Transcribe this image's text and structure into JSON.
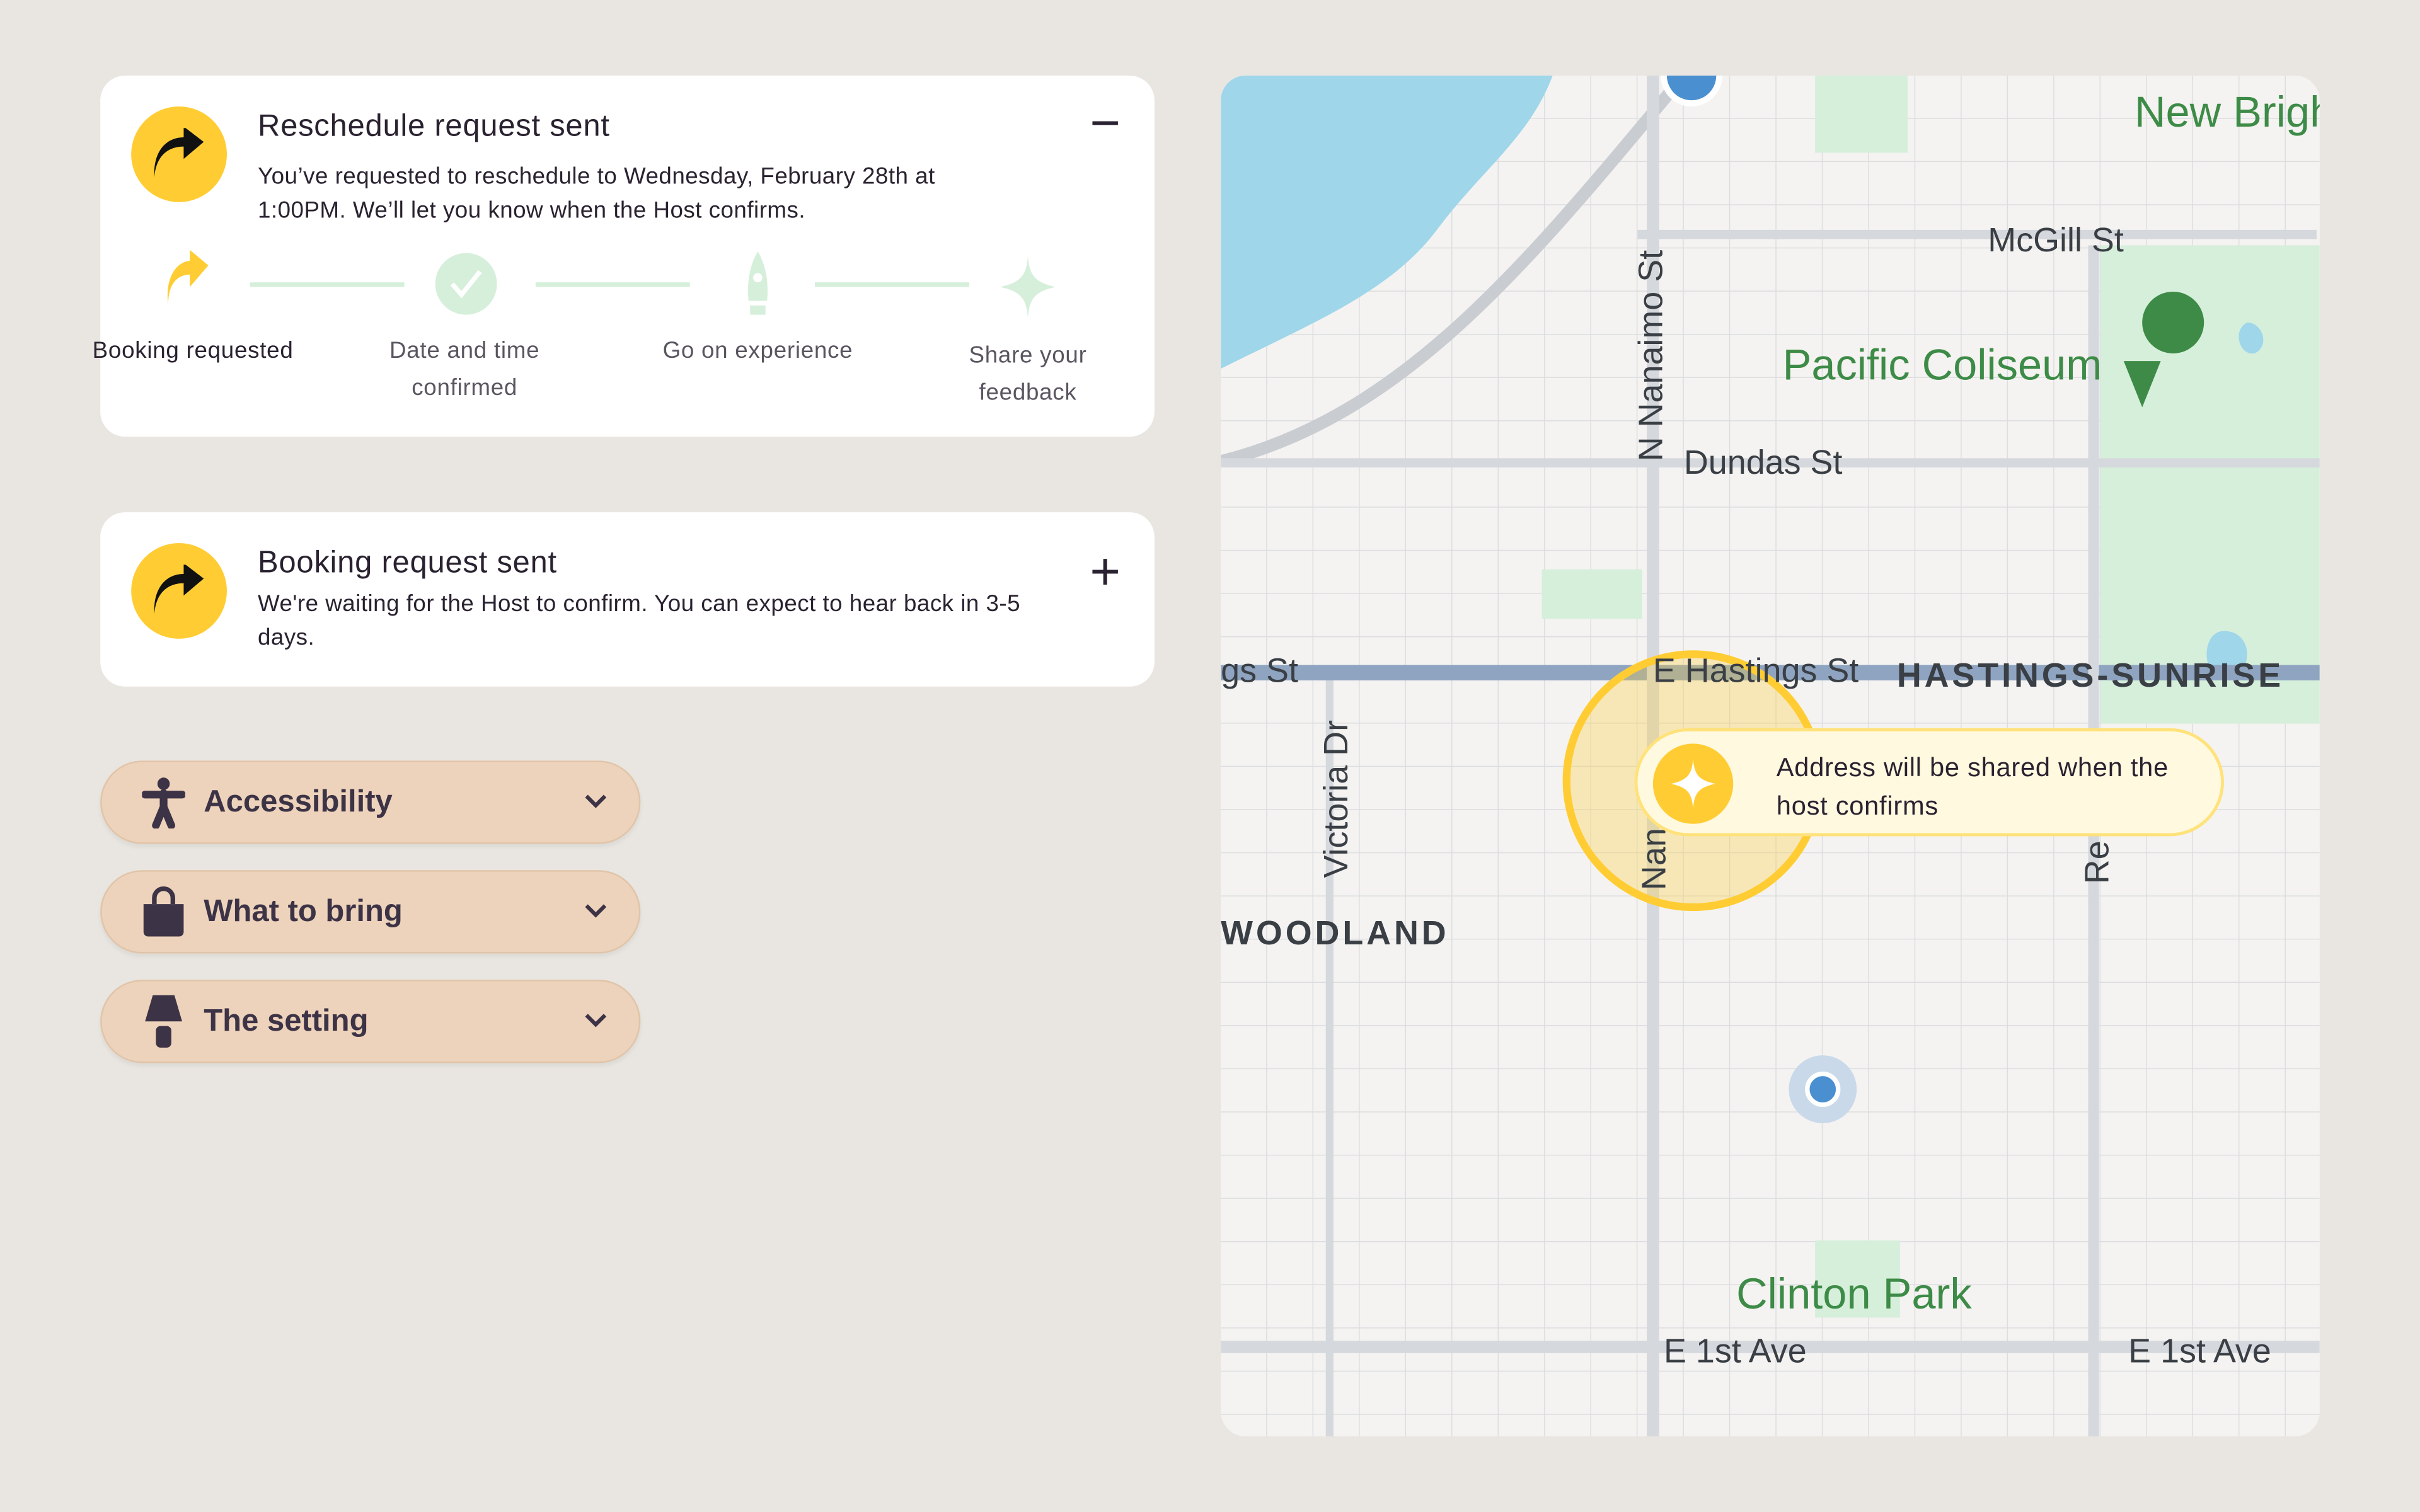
{
  "reschedule_card": {
    "title": "Reschedule request sent",
    "body": "You’ve requested to reschedule to Wednesday, February 28th at 1:00PM. We’ll let you know when the Host confirms.",
    "toggle": "−",
    "steps": [
      {
        "label": "Booking requested",
        "icon": "share-arrow-icon",
        "state": "active"
      },
      {
        "label": "Date and time confirmed",
        "icon": "check-circle-icon",
        "state": "pending"
      },
      {
        "label": "Go on experience",
        "icon": "rocket-icon",
        "state": "pending"
      },
      {
        "label": "Share your feedback",
        "icon": "sparkle-icon",
        "state": "pending"
      }
    ]
  },
  "booking_card": {
    "title": "Booking request sent",
    "body": "We're waiting for the Host to confirm. You can expect to hear back in 3-5 days.",
    "toggle": "+"
  },
  "accordions": [
    {
      "label": "Accessibility",
      "icon": "accessibility-icon"
    },
    {
      "label": "What to bring",
      "icon": "bag-icon"
    },
    {
      "label": "The setting",
      "icon": "lamp-icon"
    }
  ],
  "map": {
    "tooltip": "Address will be shared when the host confirms",
    "labels": {
      "new_brighton": "New Brigh Park",
      "mcgill": "McGill St",
      "pacific_coliseum": "Pacific Coliseum",
      "dundas": "Dundas St",
      "nanaimo": "N Nanaimo St",
      "hastings_w": "gs St",
      "hastings_e": "E Hastings St",
      "hastings_sunrise": "HASTINGS-SUNRISE",
      "victoria": "Victoria Dr",
      "woodland": "WOODLAND",
      "clinton_park": "Clinton Park",
      "first_ave_w": "E 1st Ave",
      "first_ave_e": "E 1st Ave",
      "nanaimo_s": "Nan",
      "renfrew": "Re"
    }
  },
  "colors": {
    "accent": "#ffcd33",
    "background": "#e9e6e1",
    "accordion": "#edd3bb",
    "step_pending": "#d6efdb",
    "park": "#3d8b47",
    "water": "#9fd6ea"
  }
}
